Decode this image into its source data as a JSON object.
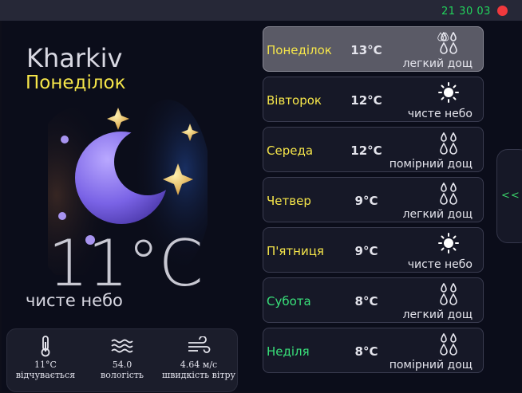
{
  "window": {
    "clock": "21 30 03",
    "close_color": "#f0393d"
  },
  "current": {
    "city": "Kharkiv",
    "day": "Понеділок",
    "temperature": "11°C",
    "condition": "чисте небо",
    "art_icon": "crescent-moon-with-stars"
  },
  "stats": [
    {
      "icon": "thermometer-icon",
      "value": "11°C",
      "label": "відчувається"
    },
    {
      "icon": "waves-icon",
      "value": "54.0",
      "label": "вологість"
    },
    {
      "icon": "wind-icon",
      "value": "4.64 м/с",
      "label": "швидкість вітру"
    }
  ],
  "forecast": [
    {
      "day": "Понеділок",
      "temp": "13°C",
      "desc": "легкий дощ",
      "icon": "rain-drops-icon",
      "day_color": "#f6e64a",
      "selected": true
    },
    {
      "day": "Вівторок",
      "temp": "12°C",
      "desc": "чисте небо",
      "icon": "sun-icon",
      "day_color": "#f6e64a"
    },
    {
      "day": "Середа",
      "temp": "12°C",
      "desc": "помірний дощ",
      "icon": "rain-drops-icon",
      "day_color": "#f6e64a"
    },
    {
      "day": "Четвер",
      "temp": "9°C",
      "desc": "легкий дощ",
      "icon": "rain-drops-icon",
      "day_color": "#f6e64a"
    },
    {
      "day": "П'ятниця",
      "temp": "9°C",
      "desc": "чисте небо",
      "icon": "sun-icon",
      "day_color": "#f6e64a"
    },
    {
      "day": "Субота",
      "temp": "8°C",
      "desc": "легкий дощ",
      "icon": "rain-drops-icon",
      "day_color": "#39e07a"
    },
    {
      "day": "Неділя",
      "temp": "8°C",
      "desc": "помірний дощ",
      "icon": "rain-drops-icon",
      "day_color": "#39e07a"
    }
  ],
  "side_toggle": {
    "label": "<<"
  },
  "colors": {
    "background": "#0b0d1a",
    "accent_yellow": "#f6e64a",
    "accent_green": "#39e07a",
    "clock_green": "#22d35c"
  }
}
